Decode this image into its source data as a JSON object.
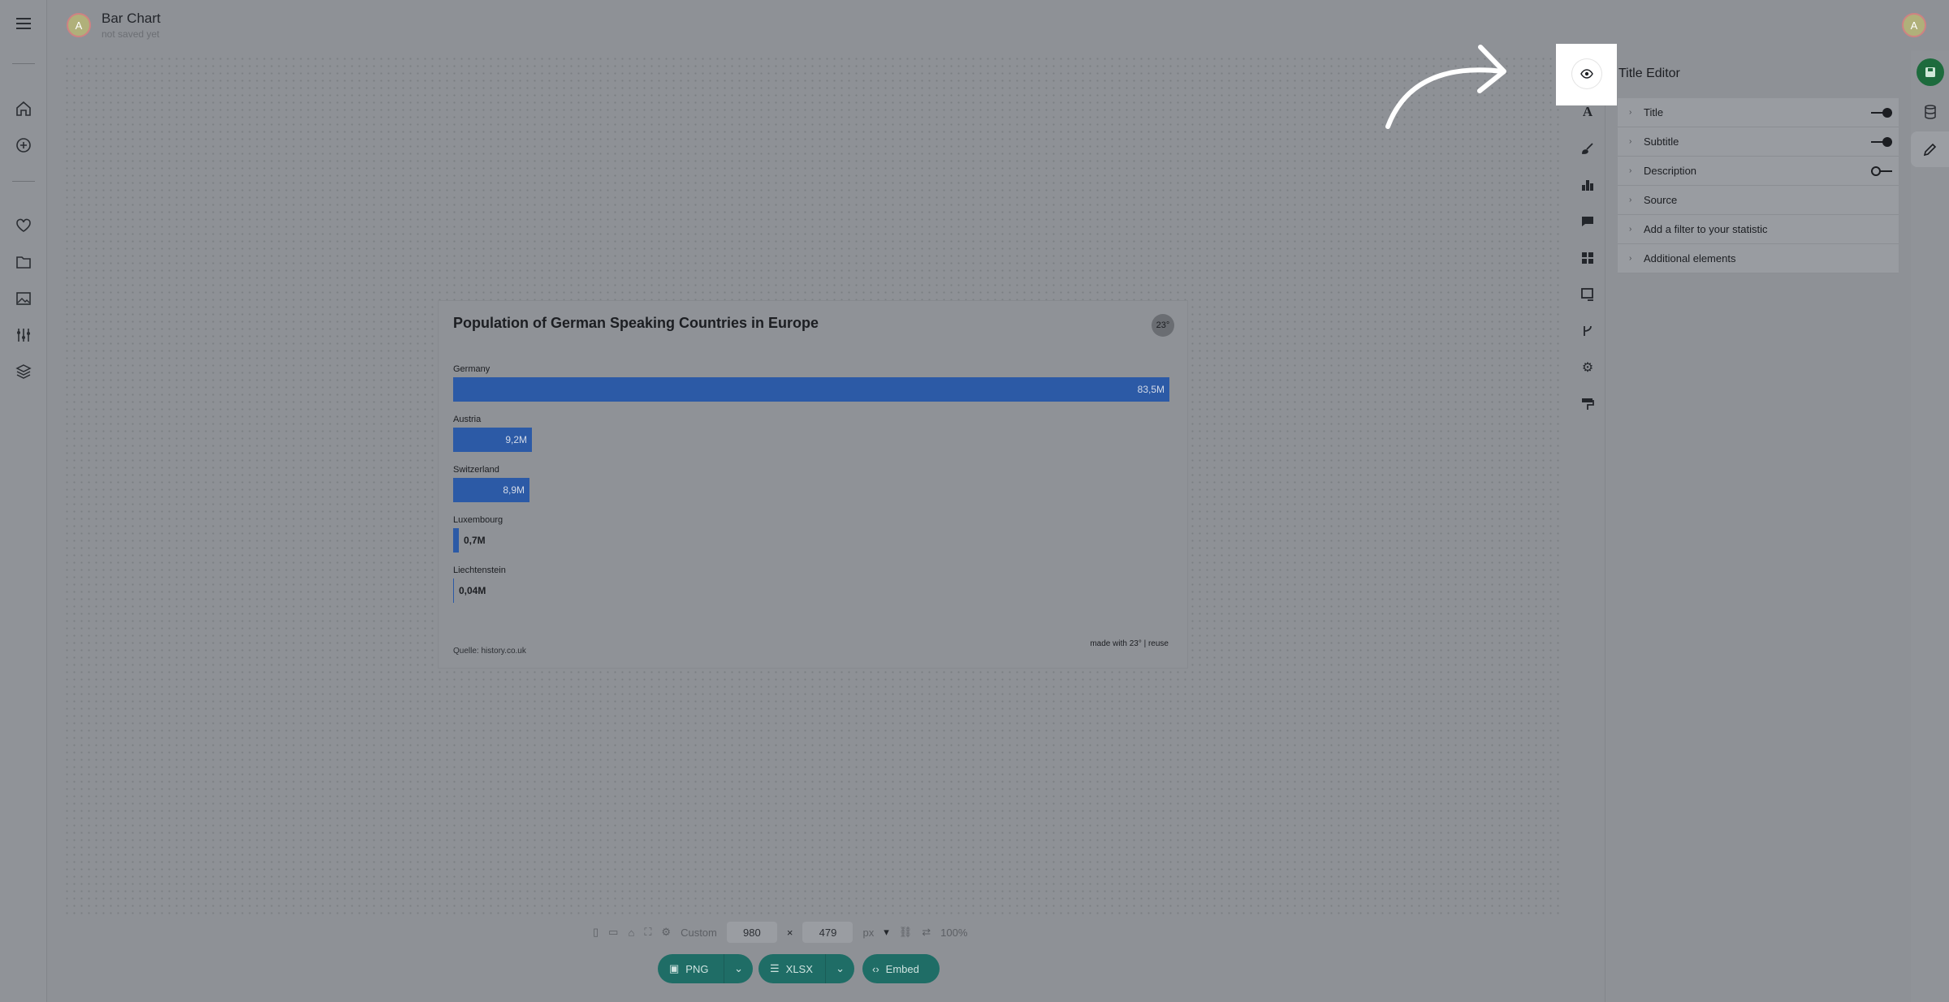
{
  "header": {
    "doc_title": "Bar Chart",
    "doc_subtitle": "not saved yet",
    "avatar_initial": "A",
    "user_initial": "A"
  },
  "left_rail": {
    "items": [
      "menu-icon",
      "home-icon",
      "add-icon",
      "heart-icon",
      "folder-icon",
      "image-icon",
      "sliders-icon",
      "layers-icon"
    ]
  },
  "chart_data": {
    "type": "bar",
    "title": "Population of German Speaking Countries in Europe",
    "categories": [
      "Germany",
      "Austria",
      "Switzerland",
      "Luxembourg",
      "Liechtenstein"
    ],
    "values": [
      83.5,
      9.2,
      8.9,
      0.7,
      0.04
    ],
    "value_labels": [
      "83,5M",
      "9,2M",
      "8,9M",
      "0,7M",
      "0,04M"
    ],
    "orientation": "horizontal",
    "bar_color": "#2c5aa6",
    "source": "Quelle: history.co.uk",
    "footer": "made with 23° | reuse",
    "logo_text": "23°"
  },
  "size_bar": {
    "preset": "Custom",
    "width": "980",
    "times": "×",
    "height": "479",
    "unit": "px",
    "zoom": "100%"
  },
  "export": {
    "png": "PNG",
    "xlsx": "XLSX",
    "embed": "Embed"
  },
  "panel": {
    "title": "Title Editor",
    "rows": [
      {
        "label": "Title",
        "toggle": "on"
      },
      {
        "label": "Subtitle",
        "toggle": "on"
      },
      {
        "label": "Description",
        "toggle": "off"
      },
      {
        "label": "Source",
        "toggle": "none"
      },
      {
        "label": "Add a filter to your statistic",
        "toggle": "none"
      },
      {
        "label": "Additional elements",
        "toggle": "none"
      }
    ]
  },
  "tool_strip": {
    "items": [
      "eye-icon",
      "text-icon",
      "brush-icon",
      "bar-chart-icon",
      "comment-icon",
      "grid-icon",
      "image-edit-icon",
      "branch-icon",
      "gear-icon",
      "paint-roller-icon"
    ]
  },
  "colors": {
    "accent": "#1f6d66",
    "save": "#1d6b3d"
  }
}
